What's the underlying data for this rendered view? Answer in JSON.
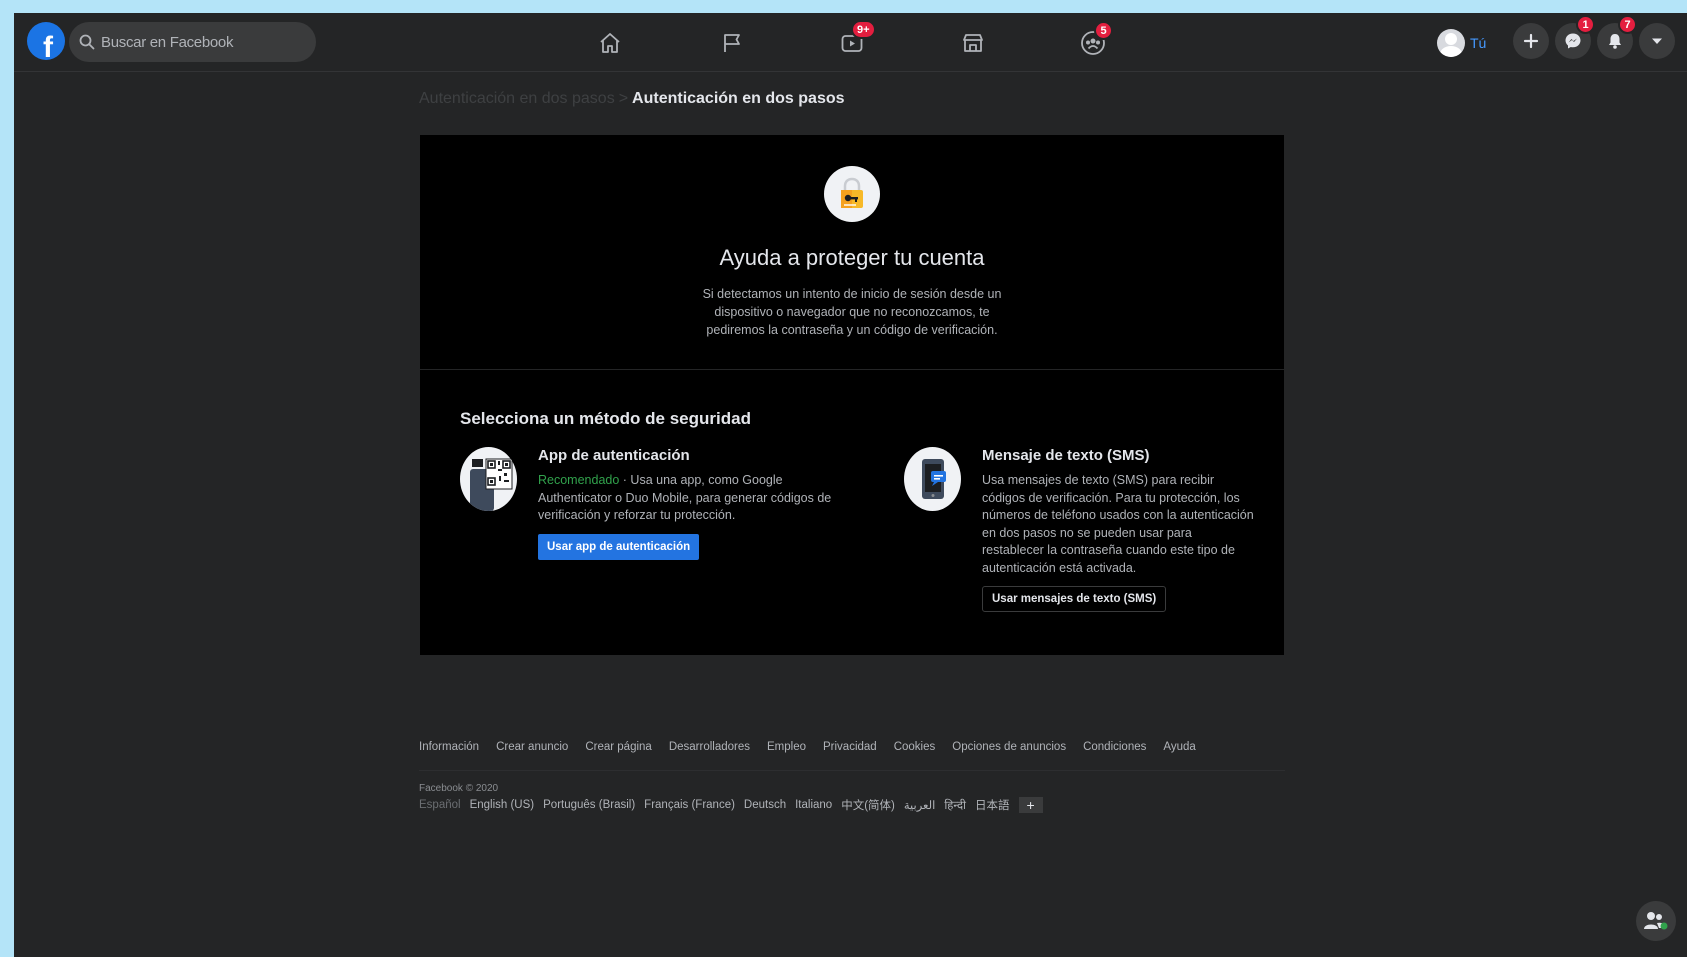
{
  "topbar": {
    "search_placeholder": "Buscar en Facebook",
    "badges": {
      "watch": "9+",
      "groups": "5",
      "messenger": "1",
      "notifications": "7"
    },
    "profile_name": "Tú"
  },
  "breadcrumb": {
    "previous": "Autenticación en dos pasos",
    "separator": ">",
    "current": "Autenticación en dos pasos"
  },
  "hero": {
    "title": "Ayuda a proteger tu cuenta",
    "description": "Si detectamos un intento de inicio de sesión desde un dispositivo o navegador que no reconozcamos, te pediremos la contraseña y un código de verificación."
  },
  "methods": {
    "title": "Selecciona un método de seguridad",
    "app": {
      "title": "App de autenticación",
      "recommended": "Recomendado",
      "description": " · Usa una app, como Google Authenticator o Duo Mobile, para generar códigos de verificación y reforzar tu protección.",
      "button": "Usar app de autenticación"
    },
    "sms": {
      "title": "Mensaje de texto (SMS)",
      "description": "Usa mensajes de texto (SMS) para recibir códigos de verificación. Para tu protección, los números de teléfono usados con la autenticación en dos pasos no se pueden usar para restablecer la contraseña cuando este tipo de autenticación está activada.",
      "button": "Usar mensajes de texto (SMS)"
    }
  },
  "footer": {
    "links": [
      "Información",
      "Crear anuncio",
      "Crear página",
      "Desarrolladores",
      "Empleo",
      "Privacidad",
      "Cookies",
      "Opciones de anuncios",
      "Condiciones",
      "Ayuda"
    ],
    "copyright": "Facebook © 2020",
    "current_language": "Español",
    "languages": [
      "English (US)",
      "Português (Brasil)",
      "Français (France)",
      "Deutsch",
      "Italiano",
      "中文(简体)",
      "العربية",
      "हिन्दी",
      "日本語"
    ],
    "add_language": "+"
  },
  "icons": {
    "logo": "facebook-logo",
    "nav": [
      "home-icon",
      "pages-flag-icon",
      "watch-icon",
      "marketplace-icon",
      "groups-icon"
    ],
    "actions": [
      "create-plus-icon",
      "messenger-icon",
      "notifications-bell-icon",
      "account-menu-caret-icon"
    ]
  },
  "colors": {
    "accent": "#2374e1",
    "badge": "#e41e3f",
    "recommended": "#31a24c",
    "background": "#242526",
    "card": "#000000"
  }
}
